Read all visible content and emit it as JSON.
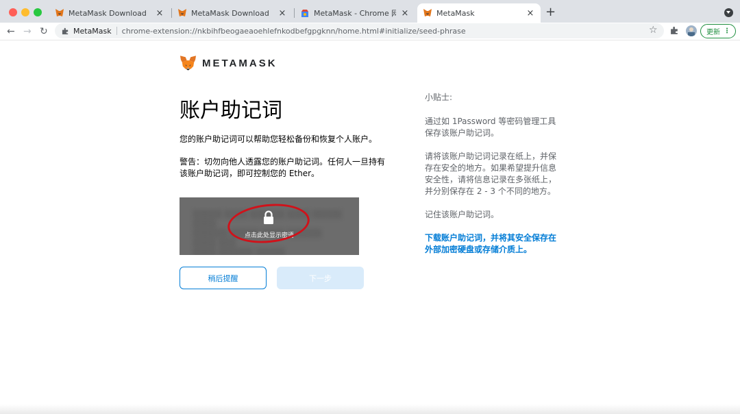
{
  "tabs": [
    {
      "title": "MetaMask Download",
      "close": "×",
      "favicon": "metamask-fox"
    },
    {
      "title": "MetaMask Download",
      "close": "×",
      "favicon": "metamask-fox"
    },
    {
      "title": "MetaMask - Chrome 网上应用店",
      "close": "×",
      "favicon": "chrome-web-store"
    },
    {
      "title": "MetaMask",
      "close": "×",
      "favicon": "metamask-fox",
      "active": true
    }
  ],
  "toolbar": {
    "back": "←",
    "forward": "→",
    "reload": "↻",
    "site_name": "MetaMask",
    "url": "chrome-extension://nkbihfbeogaeaoehlefnkodbefgpgknn/home.html#initialize/seed-phrase",
    "star": "☆",
    "update_label": "更新",
    "update_menu": "⋮",
    "new_tab": "+"
  },
  "page": {
    "logo_text": "METAMASK",
    "title": "账户助记词",
    "description": "您的账户助记词可以帮助您轻松备份和恢复个人账户。",
    "warning": "警告：切勿向他人透露您的账户助记词。任何人一旦持有该账户助记词，即可控制您的 Ether。",
    "reveal_caption": "点击此处显示密语",
    "remind_later": "稍后提醒",
    "next": "下一步"
  },
  "tips": {
    "title": "小贴士:",
    "tip1": "通过如 1Password 等密码管理工具保存该账户助记词。",
    "tip2": "请将该账户助记词记录在纸上，并保存在安全的地方。如果希望提升信息安全性，请将信息记录在多张纸上，并分别保存在 2 - 3 个不同的地方。",
    "tip3": "记住该账户助记词。",
    "download_link": "下载账户助记词，并将其安全保存在外部加密硬盘或存储介质上。"
  },
  "colors": {
    "accent": "#037dd6",
    "next_disabled": "#d9ebfa",
    "annotation_ring": "#d0121a",
    "update_green": "#1e8e3e"
  }
}
